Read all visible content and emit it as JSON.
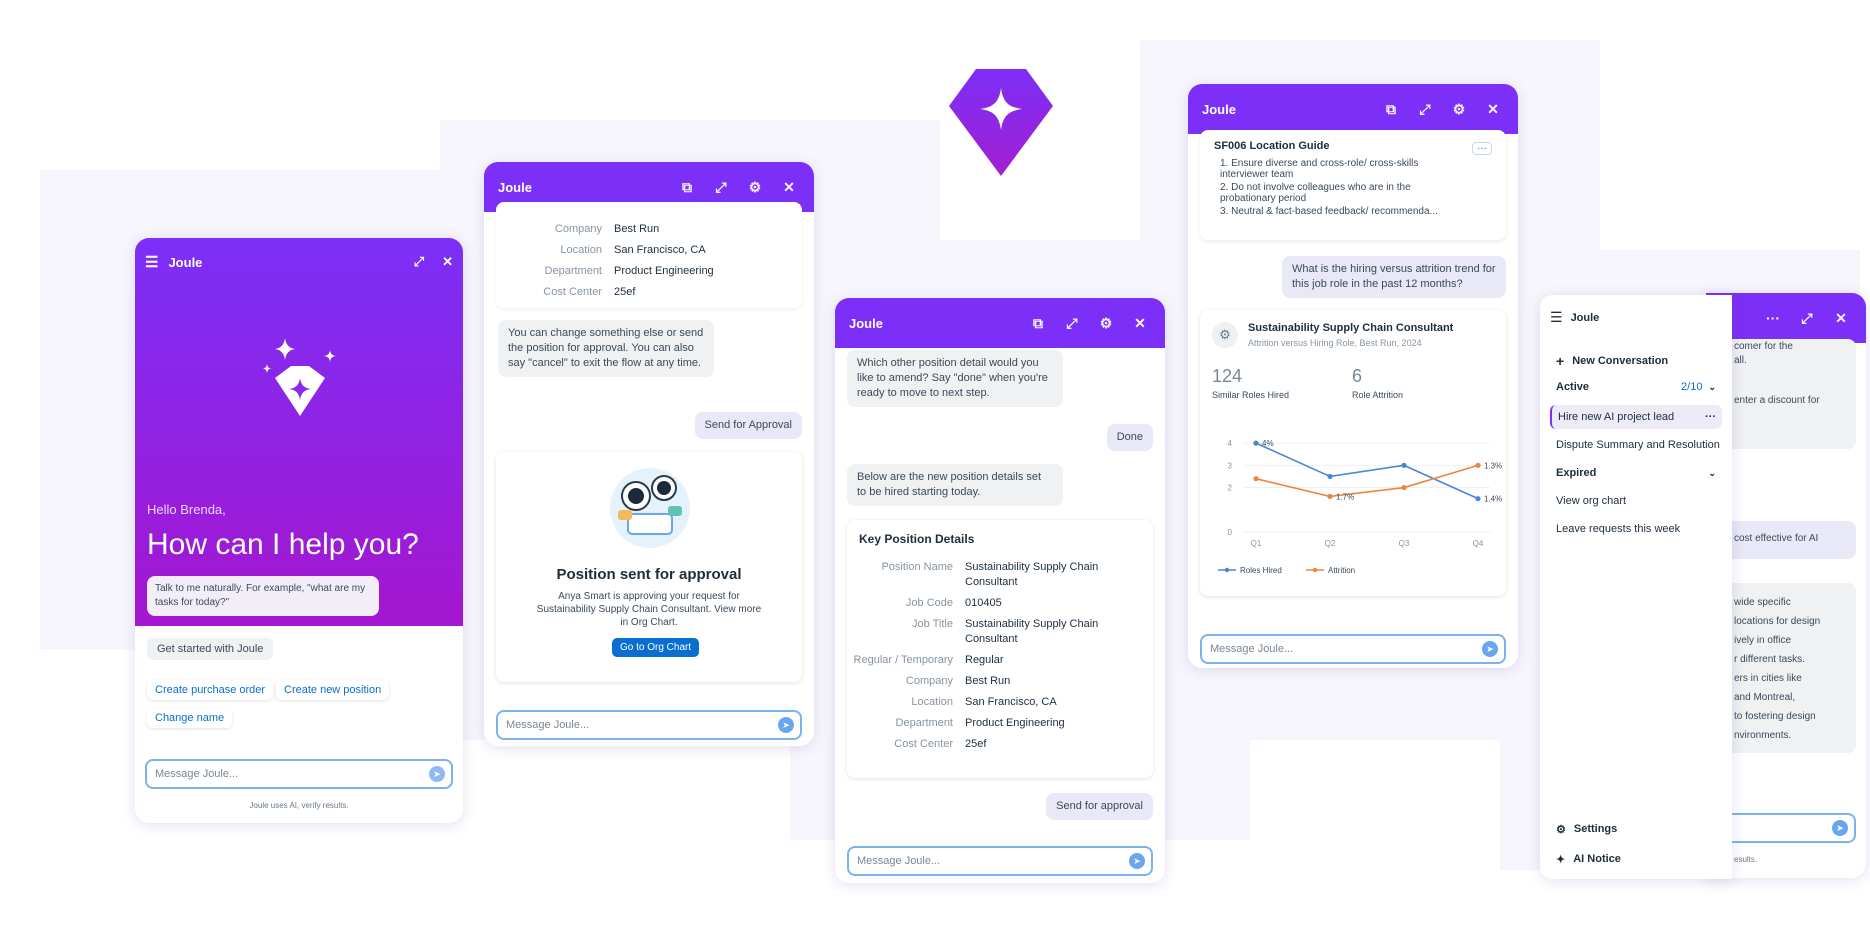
{
  "colors": {
    "brand": "#7c2ff7",
    "brand_dark": "#6a1cd9",
    "accent_blue": "#0a6ed1",
    "input_border": "#7bb3ef",
    "line_blue": "#4a86d8",
    "line_orange": "#f0843c"
  },
  "w1": {
    "title": "Joule",
    "greeting": "Hello Brenda,",
    "headline": "How can I help you?",
    "hint": "Talk to me naturally. For example, \"what are my tasks for today?\"",
    "get_started": "Get started with Joule",
    "chips": [
      "Create purchase order",
      "Create new position",
      "Change name"
    ],
    "input_placeholder": "Message Joule...",
    "disclaimer": "Joule uses AI, verify results."
  },
  "w2": {
    "title": "Joule",
    "details": [
      {
        "k": "Company",
        "v": "Best Run"
      },
      {
        "k": "Location",
        "v": "San Francisco, CA"
      },
      {
        "k": "Department",
        "v": "Product Engineering"
      },
      {
        "k": "Cost Center",
        "v": "25ef"
      }
    ],
    "bot_msg": "You can change something else or send the position for approval. You can also say \"cancel\" to exit the flow at any time.",
    "user_msg": "Send for Approval",
    "success_title": "Position sent for approval",
    "success_text": "Anya Smart is approving your request for Sustainability Supply Chain Consultant. View more in Org Chart.",
    "success_button": "Go to Org Chart",
    "input_placeholder": "Message Joule..."
  },
  "w3": {
    "title": "Joule",
    "bot_msg1": "Which other position detail would you like to amend? Say \"done\" when you're ready to move to next step.",
    "user_msg1": "Done",
    "bot_msg2": "Below are the new position details set to be hired starting today.",
    "card_title": "Key Position Details",
    "details": [
      {
        "k": "Position Name",
        "v": "Sustainability Supply Chain Consultant"
      },
      {
        "k": "Job Code",
        "v": "010405"
      },
      {
        "k": "Job Title",
        "v": "Sustainability Supply Chain Consultant"
      },
      {
        "k": "Regular / Temporary",
        "v": "Regular"
      },
      {
        "k": "Company",
        "v": "Best Run"
      },
      {
        "k": "Location",
        "v": "San Francisco, CA"
      },
      {
        "k": "Department",
        "v": "Product Engineering"
      },
      {
        "k": "Cost Center",
        "v": "25ef"
      }
    ],
    "user_msg2": "Send for approval",
    "input_placeholder": "Message Joule..."
  },
  "w4": {
    "title": "Joule",
    "guide_title": "SF006 Location Guide",
    "guide_items": [
      "1. Ensure diverse and cross-role/ cross-skills interviewer team",
      "2. Do not involve colleagues who are in the probationary period",
      "3. Neutral & fact-based feedback/ recommenda..."
    ],
    "user_msg": "What is the hiring versus attrition trend for this job role in the past 12 months?",
    "card_title": "Sustainability Supply Chain Consultant",
    "card_subtitle": "Attrition versus Hiring Role, Best Run, 2024",
    "kpis": [
      {
        "value": "124",
        "label": "Similar Roles Hired"
      },
      {
        "value": "6",
        "label": "Role Attrition"
      }
    ],
    "input_placeholder": "Message Joule..."
  },
  "chart_data": {
    "type": "line",
    "categories": [
      "Q1",
      "Q2",
      "Q3",
      "Q4"
    ],
    "series": [
      {
        "name": "Roles Hired",
        "values": [
          4.0,
          2.5,
          3.0,
          1.5
        ],
        "labels": [
          "4%",
          "",
          "",
          "1.4%"
        ]
      },
      {
        "name": "Attrition",
        "values": [
          2.4,
          1.6,
          2.0,
          3.0
        ],
        "labels": [
          "",
          "1.7%",
          "",
          "1.3%"
        ]
      }
    ],
    "yticks": [
      "4",
      "3",
      "2",
      "0"
    ],
    "ylim": [
      0,
      4.5
    ],
    "legend": "bottom-left"
  },
  "w5": {
    "title": "Joule",
    "new_conversation": "New Conversation",
    "active_label": "Active",
    "active_count": "2/10",
    "active_items": [
      "Hire new AI project lead",
      "Dispute Summary and Resolution"
    ],
    "expired_label": "Expired",
    "expired_items": [
      "View org chart",
      "Leave requests this week"
    ],
    "settings": "Settings",
    "ai_notice": "AI Notice",
    "right_fragments_1": [
      "comer for the",
      "all.",
      "",
      "enter a discount for"
    ],
    "right_fragments_2": "cost effective for AI",
    "right_fragments_3": [
      "wide specific",
      "locations for design",
      "ively in office",
      "r different tasks.",
      "ers in cities like",
      "and Montreal,",
      "to fostering design",
      "nvironments."
    ],
    "right_disclaimer": "esults."
  }
}
